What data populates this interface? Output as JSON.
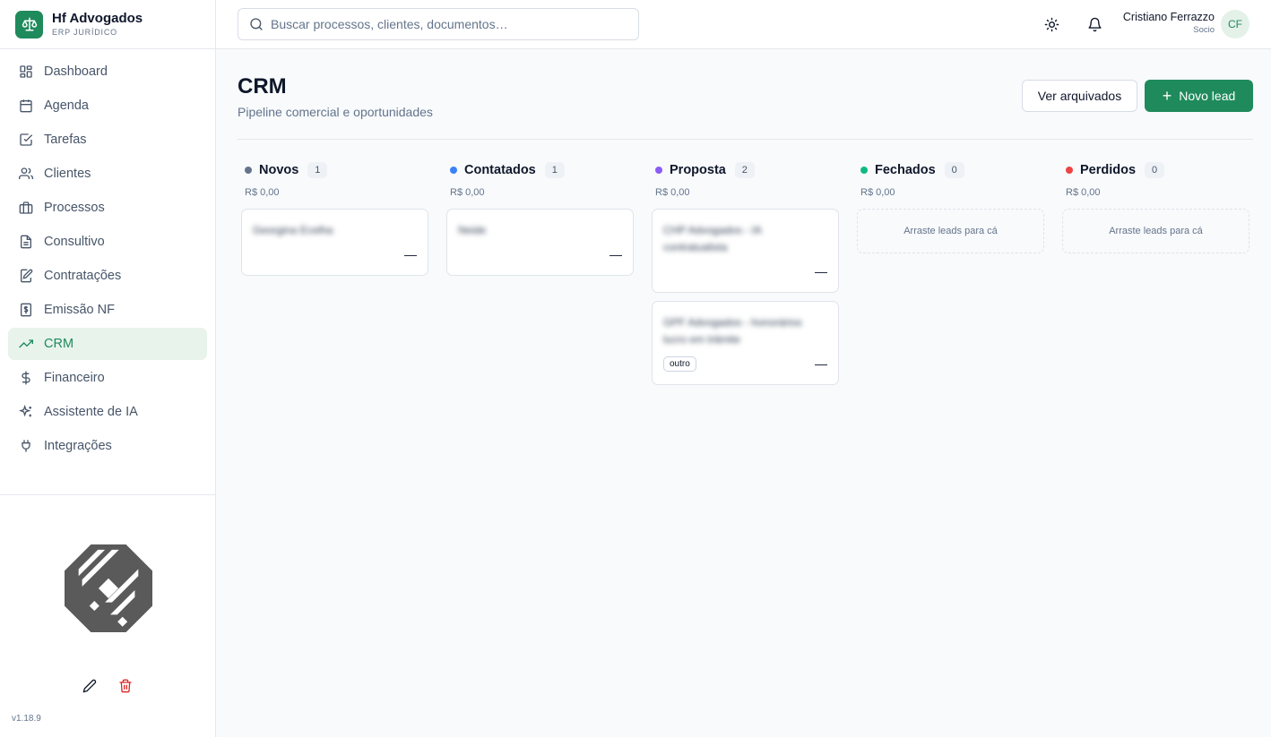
{
  "brand": {
    "name": "Hf Advogados",
    "subtitle": "ERP JURÍDICO"
  },
  "sidebar": {
    "items": [
      {
        "label": "Dashboard",
        "icon": "dashboard-icon"
      },
      {
        "label": "Agenda",
        "icon": "calendar-icon"
      },
      {
        "label": "Tarefas",
        "icon": "checkbox-icon"
      },
      {
        "label": "Clientes",
        "icon": "users-icon"
      },
      {
        "label": "Processos",
        "icon": "briefcase-icon"
      },
      {
        "label": "Consultivo",
        "icon": "document-icon"
      },
      {
        "label": "Contratações",
        "icon": "edit-document-icon"
      },
      {
        "label": "Emissão NF",
        "icon": "receipt-icon"
      },
      {
        "label": "CRM",
        "icon": "trending-up-icon",
        "active": true
      },
      {
        "label": "Financeiro",
        "icon": "dollar-icon"
      },
      {
        "label": "Assistente de IA",
        "icon": "sparkles-icon"
      },
      {
        "label": "Integrações",
        "icon": "plug-icon"
      }
    ],
    "version": "v1.18.9"
  },
  "search": {
    "placeholder": "Buscar processos, clientes, documentos…",
    "value": ""
  },
  "user": {
    "name": "Cristiano Ferrazzo",
    "role": "Socio",
    "initials": "CF"
  },
  "page": {
    "title": "CRM",
    "subtitle": "Pipeline comercial e oportunidades",
    "archived_label": "Ver arquivados",
    "new_lead_label": "Novo lead"
  },
  "columns": [
    {
      "name": "Novos",
      "count": "1",
      "total": "R$ 0,00",
      "color": "#64748b",
      "cards": [
        {
          "title": "Georgina Ecelha",
          "value": "—",
          "tag": ""
        }
      ]
    },
    {
      "name": "Contatados",
      "count": "1",
      "total": "R$ 0,00",
      "color": "#3b82f6",
      "cards": [
        {
          "title": "Neide",
          "value": "—",
          "tag": ""
        }
      ]
    },
    {
      "name": "Proposta",
      "count": "2",
      "total": "R$ 0,00",
      "color": "#8b5cf6",
      "cards": [
        {
          "title": "CHP Advogados - IA contratualista",
          "value": "—",
          "tag": ""
        },
        {
          "title": "GPF Advogados - honorários lucro em trâmite",
          "value": "—",
          "tag": "outro"
        }
      ]
    },
    {
      "name": "Fechados",
      "count": "0",
      "total": "R$ 0,00",
      "color": "#10b981",
      "cards": []
    },
    {
      "name": "Perdidos",
      "count": "0",
      "total": "R$ 0,00",
      "color": "#ef4444",
      "cards": []
    }
  ],
  "empty_column_text": "Arraste leads para cá",
  "colors": {
    "accent": "#1f8a5b",
    "accent_soft": "#e8f3ec",
    "danger": "#dc2626"
  }
}
